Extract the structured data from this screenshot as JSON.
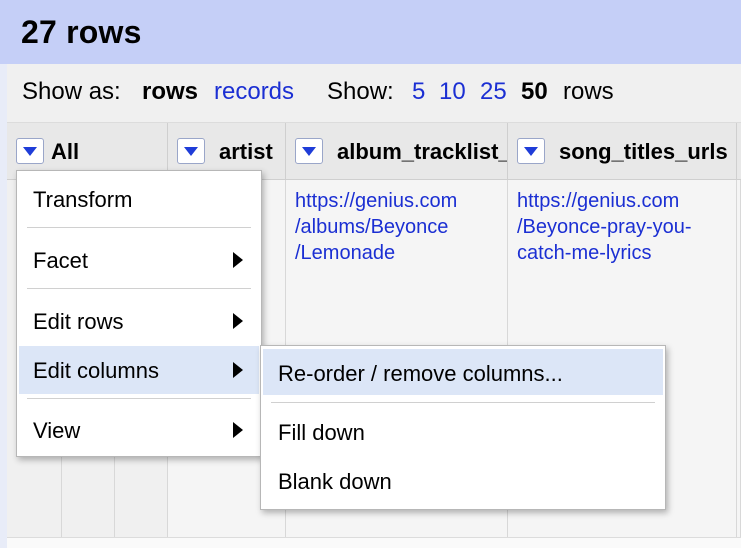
{
  "title": "27 rows",
  "view_bar": {
    "show_as_label": "Show as:",
    "rows_label": "rows",
    "records_label": "records",
    "show_label": "Show:",
    "page_sizes": [
      "5",
      "10",
      "25",
      "50"
    ],
    "active_page_size": "50",
    "rows_suffix": "rows"
  },
  "columns": [
    "All",
    "artist",
    "album_tracklist_",
    "song_titles_urls"
  ],
  "first_row": {
    "album_tracklist_url": "https://genius.com\n/albums/Beyonce\n/Lemonade",
    "song_titles_url": "https://genius.com\n/Beyonce-pray-you-\ncatch-me-lyrics"
  },
  "menu": {
    "items": [
      {
        "label": "Transform",
        "submenu": false
      },
      {
        "label": "Facet",
        "submenu": true
      },
      {
        "label": "Edit rows",
        "submenu": true
      },
      {
        "label": "Edit columns",
        "submenu": true
      },
      {
        "label": "View",
        "submenu": true
      }
    ]
  },
  "submenu": {
    "items": [
      "Re-order / remove columns...",
      "Fill down",
      "Blank down"
    ]
  },
  "colors": {
    "title_bar": "#c5cff7",
    "link": "#1b2fd3",
    "highlight": "#dce6f7"
  }
}
